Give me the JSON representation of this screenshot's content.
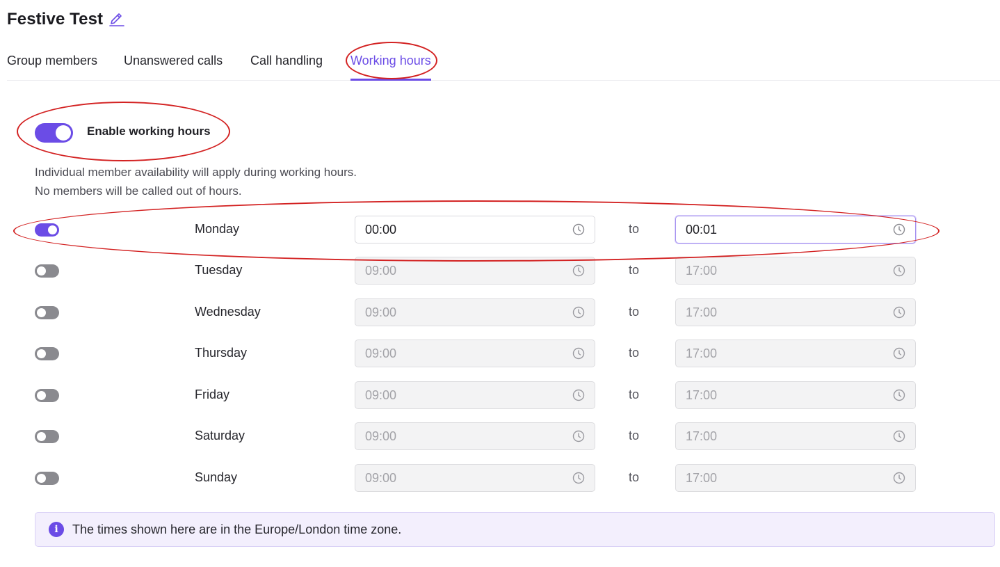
{
  "header": {
    "title": "Festive Test",
    "edit_icon": "pencil-icon"
  },
  "tabs": [
    {
      "label": "Group members",
      "active": false
    },
    {
      "label": "Unanswered calls",
      "active": false
    },
    {
      "label": "Call handling",
      "active": false
    },
    {
      "label": "Working hours",
      "active": true
    }
  ],
  "enable": {
    "label": "Enable working hours",
    "on": true
  },
  "description": {
    "line1": "Individual member availability will apply during working hours.",
    "line2": "No members will be called out of hours."
  },
  "days": [
    {
      "name": "Monday",
      "enabled": true,
      "from": "00:00",
      "to": "00:01"
    },
    {
      "name": "Tuesday",
      "enabled": false,
      "from": "09:00",
      "to": "17:00"
    },
    {
      "name": "Wednesday",
      "enabled": false,
      "from": "09:00",
      "to": "17:00"
    },
    {
      "name": "Thursday",
      "enabled": false,
      "from": "09:00",
      "to": "17:00"
    },
    {
      "name": "Friday",
      "enabled": false,
      "from": "09:00",
      "to": "17:00"
    },
    {
      "name": "Saturday",
      "enabled": false,
      "from": "09:00",
      "to": "17:00"
    },
    {
      "name": "Sunday",
      "enabled": false,
      "from": "09:00",
      "to": "17:00"
    }
  ],
  "to_label": "to",
  "info": {
    "icon": "info-icon",
    "text": "The times shown here are in the Europe/London time zone."
  },
  "colors": {
    "accent": "#6b4ce6",
    "annotation": "#d32222",
    "toggle_off": "#8a8a8f"
  }
}
